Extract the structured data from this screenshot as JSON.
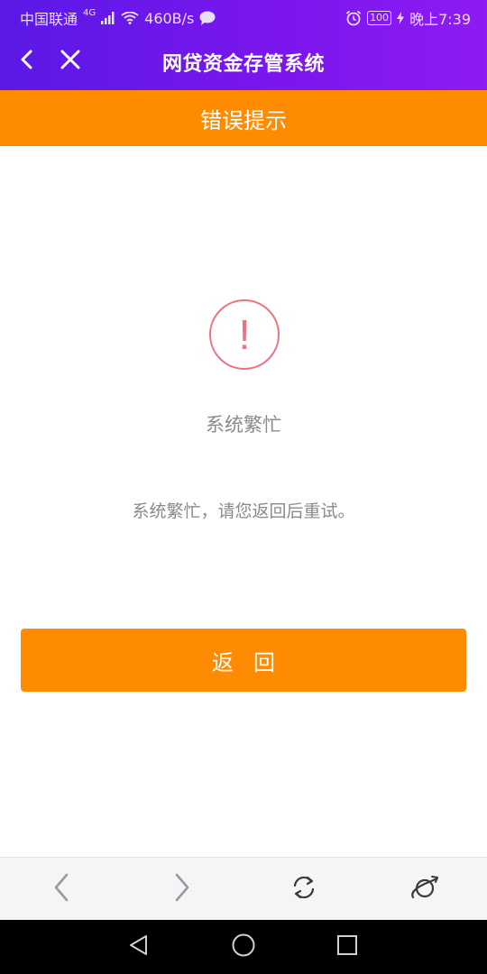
{
  "status_bar": {
    "carrier": "中国联通",
    "network_badge": "4G",
    "speed": "460B/s",
    "battery": "100",
    "time": "晚上7:39",
    "icons": [
      "signal-icon",
      "wifi-icon",
      "message-icon",
      "alarm-icon",
      "battery-icon",
      "charging-icon"
    ]
  },
  "navbar": {
    "title": "网贷资金存管系统",
    "back_icon": "chevron-left-icon",
    "close_icon": "close-icon"
  },
  "error_header": {
    "title": "错误提示"
  },
  "content": {
    "alert_symbol": "!",
    "title": "系统繁忙",
    "message": "系统繁忙，请您返回后重试。"
  },
  "return_button": {
    "label": "返回"
  },
  "browser_toolbar": {
    "icons": [
      "back-arrow-icon",
      "forward-arrow-icon",
      "refresh-icon",
      "planet-icon"
    ]
  },
  "system_nav": {
    "icons": [
      "nav-back-icon",
      "nav-home-icon",
      "nav-recents-icon"
    ]
  },
  "colors": {
    "header_gradient_start": "#5a19e6",
    "header_gradient_end": "#8f1af3",
    "accent_orange": "#ff8c00",
    "alert_red": "#f0707f",
    "text_gray": "#8a8a8a"
  }
}
